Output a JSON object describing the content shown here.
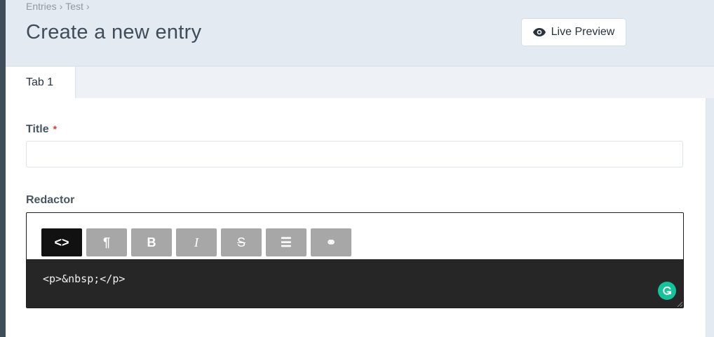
{
  "breadcrumb": [
    "Entries",
    "Test"
  ],
  "breadcrumb_sep": "›",
  "page_title": "Create a new entry",
  "live_preview": {
    "label": "Live Preview",
    "icon": "eye-icon"
  },
  "tabs": [
    {
      "label": "Tab 1",
      "active": true
    }
  ],
  "fields": {
    "title": {
      "label": "Title",
      "required_mark": "*",
      "value": ""
    },
    "redactor": {
      "label": "Redactor",
      "toolbar": [
        {
          "name": "html-source",
          "glyph": "<>",
          "active": true
        },
        {
          "name": "format",
          "glyph": "¶"
        },
        {
          "name": "bold",
          "glyph": "B"
        },
        {
          "name": "italic",
          "glyph": "I"
        },
        {
          "name": "deleted",
          "glyph": "S"
        },
        {
          "name": "lists",
          "glyph": "☰"
        },
        {
          "name": "link",
          "glyph": "⚭"
        }
      ],
      "source_code": "<p>&nbsp;</p>"
    }
  },
  "colors": {
    "header_bg": "#e4eaf1",
    "required": "#da3a2f",
    "toolbar_active": "#111111",
    "toolbar_button": "#a7a7a7",
    "source_bg": "#262626",
    "grammarly": "#15c39a"
  }
}
